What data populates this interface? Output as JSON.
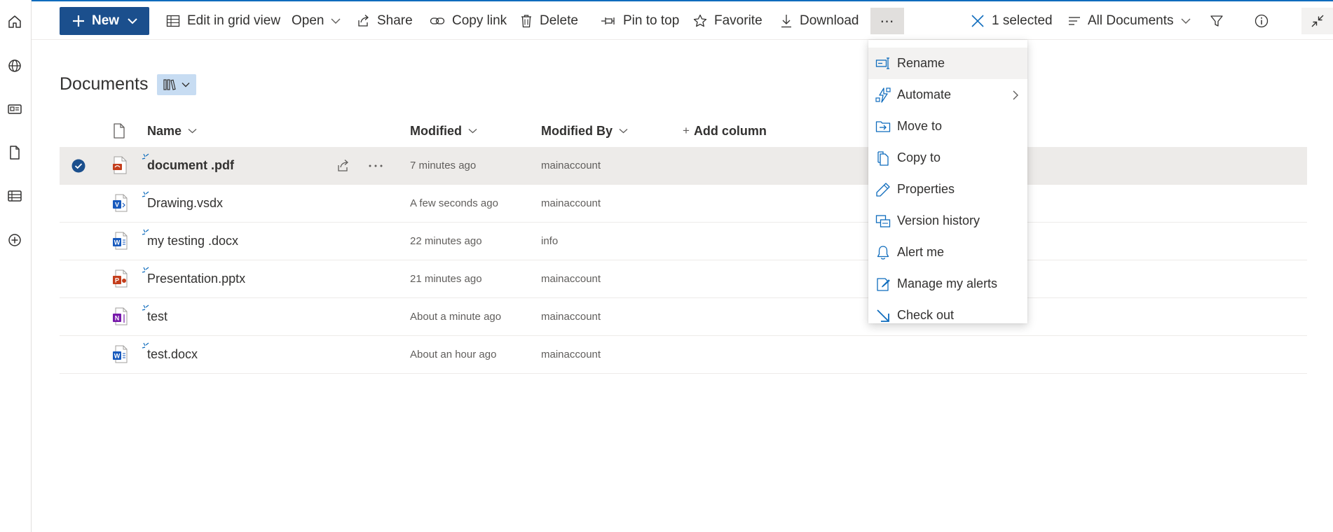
{
  "toolbar": {
    "new_label": "New",
    "edit_grid_label": "Edit in grid view",
    "open_label": "Open",
    "share_label": "Share",
    "copy_link_label": "Copy link",
    "delete_label": "Delete",
    "pin_label": "Pin to top",
    "favorite_label": "Favorite",
    "download_label": "Download",
    "more_label": "⋯",
    "selected_label": "1 selected",
    "view_label": "All Documents"
  },
  "library": {
    "title": "Documents"
  },
  "columns": {
    "name": "Name",
    "modified": "Modified",
    "modified_by": "Modified By",
    "add_column": "Add column"
  },
  "files": [
    {
      "name": "document .pdf",
      "modified": "7 minutes ago",
      "modified_by": "mainaccount",
      "type": "pdf",
      "selected": true
    },
    {
      "name": "Drawing.vsdx",
      "modified": "A few seconds ago",
      "modified_by": "mainaccount",
      "type": "visio",
      "selected": false
    },
    {
      "name": "my testing .docx",
      "modified": "22 minutes ago",
      "modified_by": "info",
      "type": "word",
      "selected": false
    },
    {
      "name": "Presentation.pptx",
      "modified": "21 minutes ago",
      "modified_by": "mainaccount",
      "type": "powerpoint",
      "selected": false
    },
    {
      "name": "test",
      "modified": "About a minute ago",
      "modified_by": "mainaccount",
      "type": "onenote",
      "selected": false
    },
    {
      "name": "test.docx",
      "modified": "About an hour ago",
      "modified_by": "mainaccount",
      "type": "word",
      "selected": false
    }
  ],
  "context_menu": {
    "items": [
      {
        "label": "Rename",
        "icon": "rename-icon"
      },
      {
        "label": "Automate",
        "icon": "automate-icon"
      },
      {
        "label": "Move to",
        "icon": "move-to-icon"
      },
      {
        "label": "Copy to",
        "icon": "copy-to-icon"
      },
      {
        "label": "Properties",
        "icon": "pencil-icon"
      },
      {
        "label": "Version history",
        "icon": "version-history-icon"
      },
      {
        "label": "Alert me",
        "icon": "bell-icon"
      },
      {
        "label": "Manage my alerts",
        "icon": "manage-alerts-icon"
      },
      {
        "label": "Check out",
        "icon": "check-out-icon"
      }
    ]
  },
  "colors": {
    "accent": "#0f6cbd",
    "new_button": "#1b4f8d",
    "selected_row": "#edebe9",
    "pdf": "#c43e1c",
    "visio": "#185abd",
    "word": "#185abd",
    "powerpoint": "#c43e1c",
    "onenote": "#7719aa"
  }
}
